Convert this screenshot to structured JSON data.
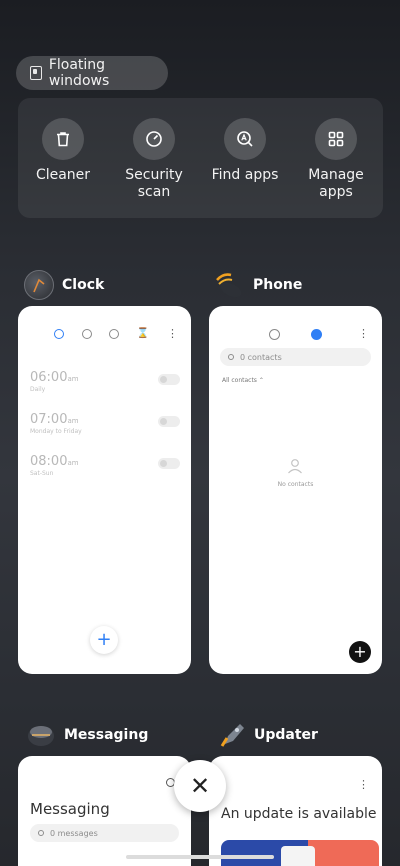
{
  "floating_windows": {
    "label": "Floating windows"
  },
  "quick_tools": [
    {
      "label": "Cleaner",
      "icon": "trash-icon"
    },
    {
      "label": "Security\nscan",
      "icon": "gauge-icon"
    },
    {
      "label": "Find apps",
      "icon": "search-app-icon"
    },
    {
      "label": "Manage\napps",
      "icon": "grid-icon"
    }
  ],
  "clock": {
    "title": "Clock",
    "alarms": [
      {
        "time": "06:00",
        "ampm": "am",
        "repeat": "Daily"
      },
      {
        "time": "07:00",
        "ampm": "am",
        "repeat": "Monday to Friday"
      },
      {
        "time": "08:00",
        "ampm": "am",
        "repeat": "Sat-Sun"
      }
    ],
    "add": "+"
  },
  "phone": {
    "title": "Phone",
    "search_placeholder": "0 contacts",
    "filter": "All contacts",
    "empty": "No contacts",
    "add": "+"
  },
  "messaging": {
    "title": "Messaging",
    "heading": "Messaging",
    "search_placeholder": "0 messages"
  },
  "updater": {
    "title": "Updater",
    "heading": "An update is available"
  },
  "close": "✕",
  "colors": {
    "accent": "#2f7ff5",
    "update_banner_left": "#2b4aa8",
    "update_banner_right": "#ef6a57"
  }
}
